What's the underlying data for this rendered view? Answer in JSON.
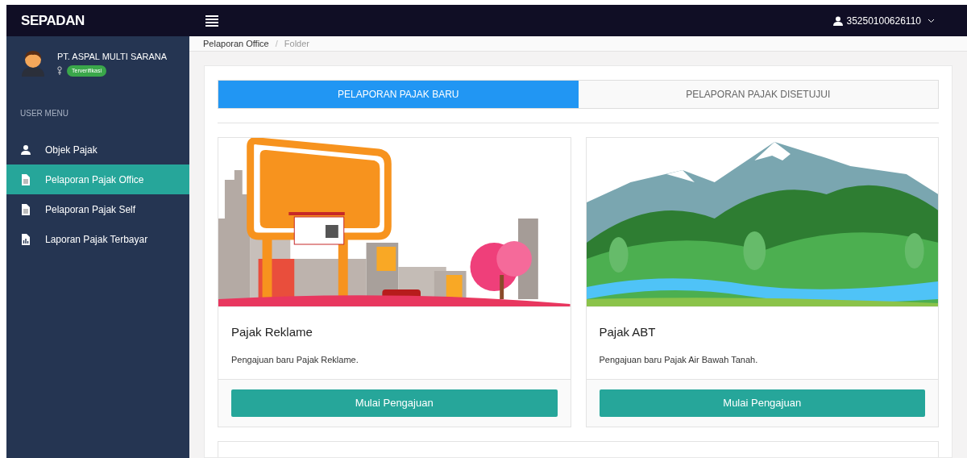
{
  "brand": "SEPADAN",
  "user": {
    "id": "35250100626110"
  },
  "profile": {
    "company": "PT. ASPAL MULTI SARANA",
    "badge": "Terverifikasi"
  },
  "sidebar": {
    "heading": "USER MENU",
    "items": [
      {
        "label": "Objek Pajak",
        "kind": "user",
        "selected": false
      },
      {
        "label": "Pelaporan Pajak Office",
        "kind": "doc",
        "selected": true
      },
      {
        "label": "Pelaporan Pajak Self",
        "kind": "doc",
        "selected": false
      },
      {
        "label": "Laporan Pajak Terbayar",
        "kind": "chart",
        "selected": false
      }
    ]
  },
  "breadcrumb": {
    "separator": "/",
    "items": [
      "Pelaporan Office",
      "Folder"
    ]
  },
  "tabs": [
    {
      "label": "PELAPORAN PAJAK BARU",
      "selected": true
    },
    {
      "label": "PELAPORAN PAJAK DISETUJUI",
      "selected": false
    }
  ],
  "cards": [
    {
      "kind": "billboard",
      "title": "Pajak Reklame",
      "description": "Pengajuan baru Pajak Reklame.",
      "button": "Mulai Pengajuan"
    },
    {
      "kind": "landscape",
      "title": "Pajak ABT",
      "description": "Pengajuan baru Pajak Air Bawah Tanah.",
      "button": "Mulai Pengajuan"
    }
  ]
}
